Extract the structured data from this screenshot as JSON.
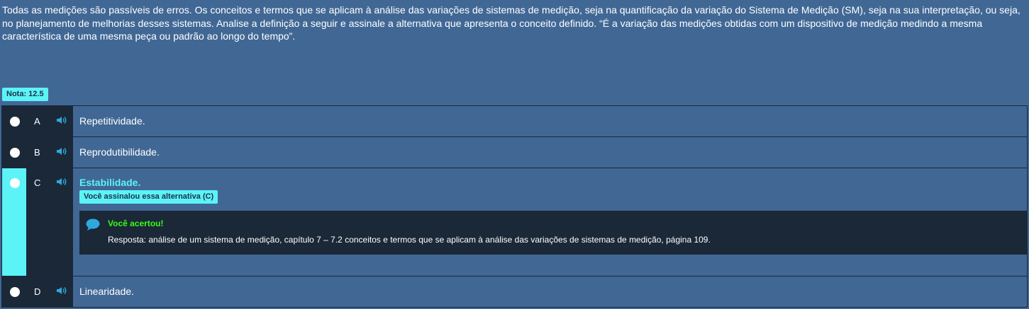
{
  "question": {
    "text": "Todas as medições são passíveis de erros. Os conceitos e termos que se aplicam à análise das variações de sistemas de medição, seja na quantificação da variação do Sistema de Medição (SM), seja na sua interpretação, ou seja, no planejamento de melhorias desses sistemas. Analise a definição a seguir e assinale a alternativa que apresenta o conceito definido. “É a variação das medições obtidas com um dispositivo de medição medindo a mesma característica de uma mesma peça ou padrão ao longo do tempo”."
  },
  "nota": "Nota: 12.5",
  "options": [
    {
      "letter": "A",
      "text": "Repetitividade."
    },
    {
      "letter": "B",
      "text": "Reprodutibilidade."
    },
    {
      "letter": "C",
      "text": "Estabilidade.",
      "selected_badge": "Você assinalou essa alternativa (C)",
      "feedback_title": "Você acertou!",
      "feedback_answer": "Resposta: análise de um sistema de medição, capítulo 7 – 7.2 conceitos e termos que se aplicam à análise das variações de sistemas de medição, página 109."
    },
    {
      "letter": "D",
      "text": "Linearidade."
    }
  ],
  "icons": {
    "radio": "radio-button-icon",
    "audio": "speaker-icon",
    "feedback": "chat-bubble-icon"
  },
  "colors": {
    "background": "#416895",
    "panel": "#1b2838",
    "accent": "#5cf3f7",
    "correct": "#39ff14"
  }
}
